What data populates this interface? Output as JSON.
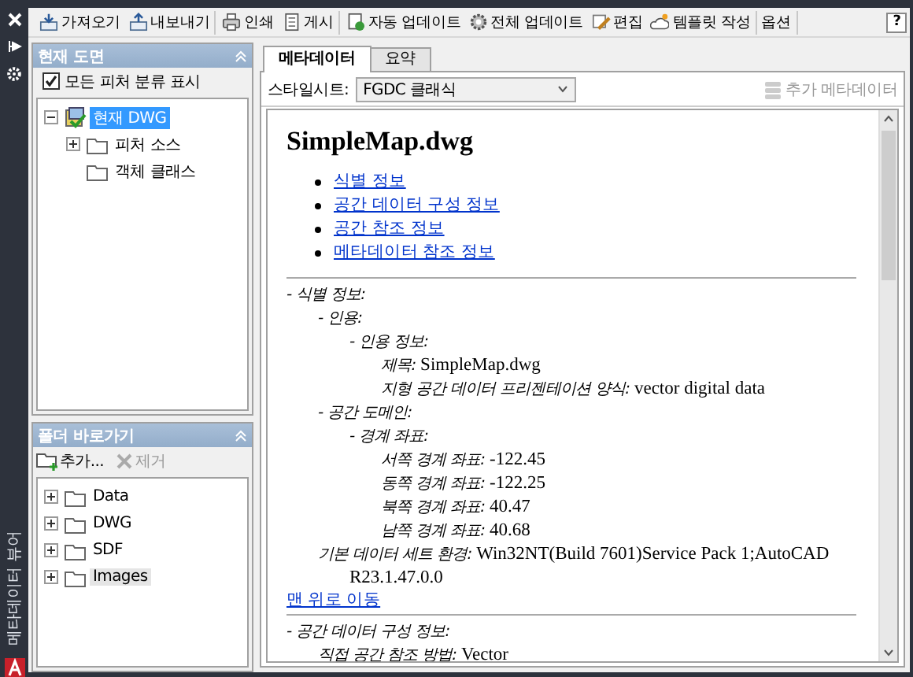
{
  "side_bar": {
    "title": "메타데이터 뷰어"
  },
  "toolbar": {
    "groups": [
      [
        {
          "label": "가져오기"
        },
        {
          "label": "내보내기"
        }
      ],
      [
        {
          "label": "인쇄"
        },
        {
          "label": "게시"
        }
      ],
      [
        {
          "label": "자동 업데이트"
        },
        {
          "label": "전체 업데이트"
        },
        {
          "label": "편집"
        },
        {
          "label": "템플릿 작성"
        }
      ],
      [
        {
          "label": "옵션"
        }
      ]
    ],
    "help": "?"
  },
  "drawing_panel": {
    "title": "현재 도면",
    "show_all": {
      "label": "모든 피처 분류 표시",
      "checked": true
    },
    "tree": [
      {
        "label": "현재 DWG",
        "expandable": true,
        "expanded": true,
        "selected": true,
        "children": [
          {
            "label": "피처 소스",
            "expandable": true,
            "expanded": false,
            "selected": false
          },
          {
            "label": "객체 클래스",
            "expandable": false,
            "selected": false
          }
        ]
      }
    ]
  },
  "folder_panel": {
    "title": "폴더 바로가기",
    "actions": [
      {
        "label": "추가...",
        "disabled": false
      },
      {
        "label": "제거",
        "disabled": true
      }
    ],
    "tree": [
      {
        "label": "Data",
        "expandable": true,
        "expanded": false,
        "selected": false
      },
      {
        "label": "DWG",
        "expandable": true,
        "expanded": false,
        "selected": false
      },
      {
        "label": "SDF",
        "expandable": true,
        "expanded": false,
        "selected": false
      },
      {
        "label": "Images",
        "expandable": true,
        "expanded": false,
        "selected": true
      }
    ]
  },
  "tabs": [
    {
      "label": "메타데이터",
      "selected": true
    },
    {
      "label": "요약",
      "selected": false
    }
  ],
  "stylesheet": {
    "label": "스타일시트:",
    "value": "FGDC 클래식"
  },
  "extra_metadata": {
    "label": "추가 메타데이터",
    "disabled": true
  },
  "document": {
    "title": "SimpleMap.dwg",
    "contents": [
      "식별 정보",
      "공간 데이터 구성 정보",
      "공간 참조 정보",
      "메타데이터 참조 정보"
    ],
    "sections": [
      {
        "entries": [
          {
            "label": "- 식별 정보:",
            "children": [
              {
                "label": "- 인용:",
                "children": [
                  {
                    "label": "- 인용 정보:",
                    "children": [
                      {
                        "label": "제목:",
                        "value": "SimpleMap.dwg"
                      },
                      {
                        "label": "지형 공간 데이터 프리젠테이션 양식:",
                        "value": "vector digital data"
                      }
                    ]
                  }
                ]
              },
              {
                "label": "- 공간 도메인:",
                "children": [
                  {
                    "label": "- 경계 좌표:",
                    "children": [
                      {
                        "label": "서쪽 경계 좌표:",
                        "value": "-122.45"
                      },
                      {
                        "label": "동쪽 경계 좌표:",
                        "value": "-122.25"
                      },
                      {
                        "label": "북쪽 경계 좌표:",
                        "value": "40.47"
                      },
                      {
                        "label": "남쪽 경계 좌표:",
                        "value": "40.68"
                      }
                    ]
                  }
                ]
              },
              {
                "label": "기본 데이터 세트 환경:",
                "value": "Win32NT(Build 7601)Service Pack 1;AutoCAD R23.1.47.0.0"
              }
            ]
          }
        ],
        "back_link": "맨 위로 이동"
      },
      {
        "entries": [
          {
            "label": "- 공간 데이터 구성 정보:",
            "children": [
              {
                "label": "직접 공간 참조 방법:",
                "value": "Vector"
              }
            ]
          }
        ]
      }
    ]
  }
}
